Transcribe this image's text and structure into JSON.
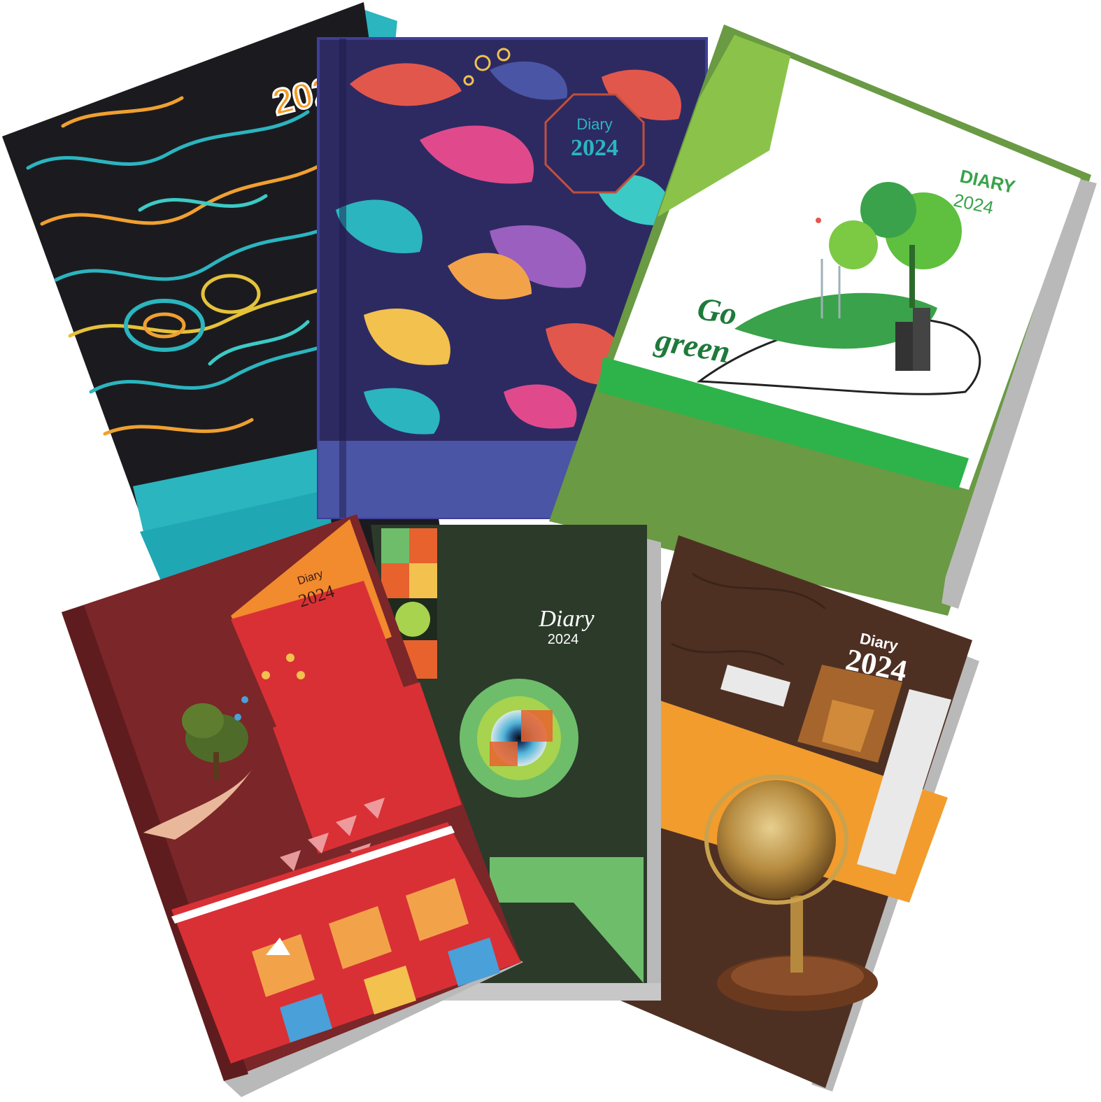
{
  "diaries": [
    {
      "id": "swirl",
      "colors": {
        "cover": "#1b1b1f",
        "band": "#2bb5bf",
        "spine": "#2aa7b3"
      },
      "title": "",
      "year": "202"
    },
    {
      "id": "leaves",
      "colors": {
        "cover": "#2d2a62",
        "band": "#4a55a5",
        "badge": "#c0503d"
      },
      "title": "Diary",
      "year": "2024"
    },
    {
      "id": "go-green",
      "colors": {
        "cover": "#ffffff",
        "band": "#6a9a43",
        "accent": "#2db34a"
      },
      "title": "DIARY",
      "year": "2024",
      "slogan_top": "Go",
      "slogan_bottom": "green"
    },
    {
      "id": "red-geometric",
      "colors": {
        "cover": "#7b2628",
        "orange": "#f28a2e",
        "red": "#d93036"
      },
      "title": "Diary",
      "year": "2024"
    },
    {
      "id": "eye",
      "colors": {
        "cover": "#2c3a2a",
        "band": "#6ebd6b"
      },
      "title": "Diary",
      "year": "2024"
    },
    {
      "id": "globe",
      "colors": {
        "cover": "#4e3023",
        "orange": "#f29c2e",
        "light": "#e9e9e9"
      },
      "title": "Diary",
      "year": "2024"
    }
  ]
}
